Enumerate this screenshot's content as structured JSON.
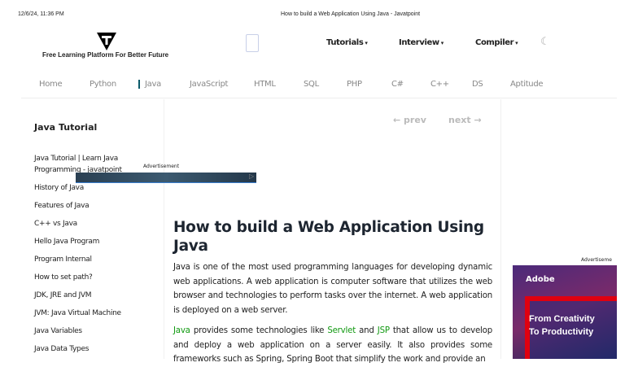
{
  "print_header": {
    "datetime": "12/6/24, 11:36 PM",
    "title": "How to build a Web Application Using Java - Javatpoint"
  },
  "header": {
    "tagline": "Free Learning Platform For Better Future",
    "menus": [
      {
        "label": "Tutorials"
      },
      {
        "label": "Interview"
      },
      {
        "label": "Compiler"
      }
    ],
    "caret": "▾",
    "moon": "☾"
  },
  "nav": [
    "Home",
    "Python",
    "Java",
    "JavaScript",
    "HTML",
    "SQL",
    "PHP",
    "C#",
    "C++",
    "DS",
    "Aptitude"
  ],
  "sidebar": {
    "title": "Java Tutorial",
    "items": [
      "Java Tutorial | Learn Java Programming - javatpoint",
      "History of Java",
      "Features of Java",
      "C++ vs Java",
      "Hello Java Program",
      "Program Internal",
      "How to set path?",
      "JDK, JRE and JVM",
      "JVM: Java Virtual Machine",
      "Java Variables",
      "Java Data Types"
    ]
  },
  "pager": {
    "prev": "← prev",
    "next": "next →"
  },
  "ads": {
    "label1": "Advertisement",
    "label2": "Advertiseme",
    "ad2_brand": "Adobe",
    "ad2_slogan1": "From Creativity",
    "ad2_slogan2": "To Productivity"
  },
  "article": {
    "title": "How to build a Web Application Using Java",
    "p1": "Java is one of the most used programming languages for developing dynamic web applications. A web application is computer software that utilizes the web browser and technologies to perform tasks over the internet. A web application is deployed on a web server.",
    "p2": {
      "link1": "Java",
      "t1": " provides some technologies like ",
      "link2": "Servlet",
      "t2": " and ",
      "link3": "JSP",
      "t3": " that allow us to develop and deploy a web application on a server easily. It also provides some frameworks such as Spring, Spring Boot that simplify the work and provide an"
    }
  },
  "colors": {
    "link": "#119911",
    "heading": "#1d2530",
    "nav_text": "#888888"
  }
}
